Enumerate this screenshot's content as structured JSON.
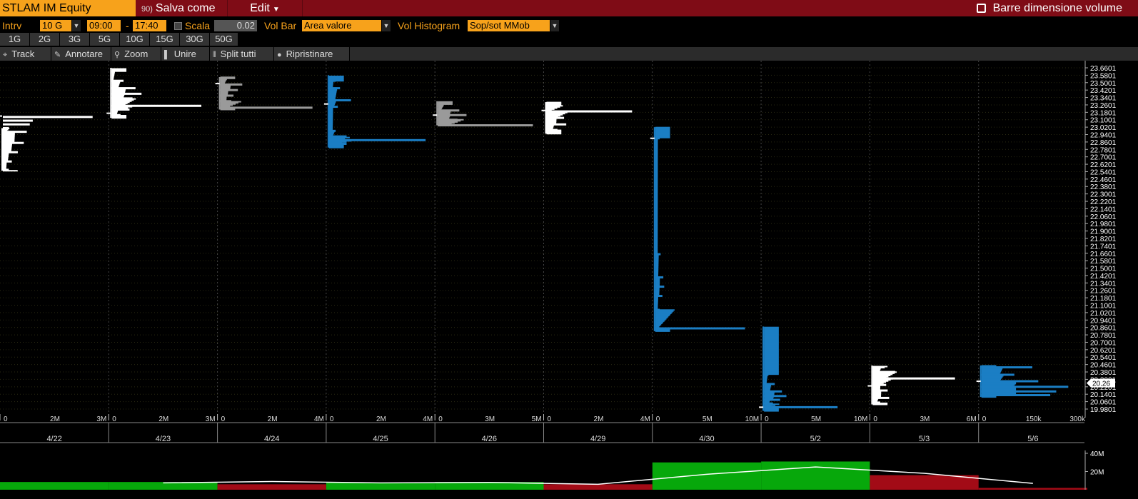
{
  "header": {
    "ticker": "STLAM IM Equity",
    "save_as": "Salva come",
    "save_icon_glyph": "90)",
    "edit": "Edit",
    "barre": "Barre dimensione volume"
  },
  "controls": {
    "intrv_label": "Intrv",
    "intrv_value": "10 G",
    "start_time": "09:00",
    "dash": "-",
    "end_time": "17:40",
    "scala_label": "Scala",
    "scala_value": "0.02",
    "volbar_label": "Vol Bar",
    "volbar_value": "Area valore",
    "volhist_label": "Vol Histogram",
    "volhist_value": "Sop/sot MMob"
  },
  "periods": [
    "1G",
    "2G",
    "3G",
    "5G",
    "10G",
    "15G",
    "30G",
    "50G"
  ],
  "toolbar": [
    {
      "label": "Track",
      "icon": "crosshair-icon",
      "glyph": "⌖"
    },
    {
      "label": "Annotare",
      "icon": "pencil-icon",
      "glyph": "✎"
    },
    {
      "label": "Zoom",
      "icon": "magnifier-icon",
      "glyph": "⚲"
    },
    {
      "label": "Unire",
      "icon": "merge-icon",
      "glyph": "▌"
    },
    {
      "label": "Split tutti",
      "icon": "split-icon",
      "glyph": "⫴"
    },
    {
      "label": "Ripristinare",
      "icon": "reset-icon",
      "glyph": "●"
    }
  ],
  "colors": {
    "title_bar": "#7f0c16",
    "accent": "#f7a21b",
    "up": "#07a80b",
    "down": "#a20b16",
    "profile_blue": "#1b7ec4",
    "profile_white": "#ffffff",
    "profile_gray": "#9a9a9a"
  },
  "chart_data": {
    "type": "bar",
    "title": "",
    "price_axis": {
      "ticks": [
        "23.6601",
        "23.5801",
        "23.5001",
        "23.4201",
        "23.3401",
        "23.2601",
        "23.1801",
        "23.1001",
        "23.0201",
        "22.9401",
        "22.8601",
        "22.7801",
        "22.7001",
        "22.6201",
        "22.5401",
        "22.4601",
        "22.3801",
        "22.3001",
        "22.2201",
        "22.1401",
        "22.0601",
        "21.9801",
        "21.9001",
        "21.8201",
        "21.7401",
        "21.6601",
        "21.5801",
        "21.5001",
        "21.4201",
        "21.3401",
        "21.2601",
        "21.1801",
        "21.1001",
        "21.0201",
        "20.9401",
        "20.8601",
        "20.7801",
        "20.7001",
        "20.6201",
        "20.5401",
        "20.4601",
        "20.3801",
        "20.3001",
        "20.2201",
        "20.1401",
        "20.0601",
        "19.9801"
      ],
      "last_price": "20.26",
      "range": [
        19.95,
        23.7
      ]
    },
    "sessions": [
      {
        "date": "4/22",
        "color": "white",
        "high": 23.01,
        "low": 22.55,
        "close": 23.14,
        "poc": 23.13,
        "axis_labels": [
          "0",
          "2M",
          "3M"
        ],
        "axis_max": 3.3,
        "poc_volume": 3.0,
        "profile": [
          [
            23.01,
            0.2
          ],
          [
            23.13,
            3.0
          ],
          [
            23.09,
            1.0
          ],
          [
            23.05,
            0.9
          ],
          [
            22.97,
            0.8
          ],
          [
            22.85,
            0.7
          ],
          [
            22.75,
            0.5
          ],
          [
            22.65,
            0.3
          ],
          [
            22.56,
            0.2
          ]
        ]
      },
      {
        "date": "4/23",
        "color": "white",
        "high": 23.66,
        "low": 23.12,
        "close": 23.17,
        "poc": 23.25,
        "axis_labels": [
          "0",
          "2M",
          "3M"
        ],
        "axis_max": 3.3,
        "poc_volume": 3.0,
        "profile": [
          [
            23.62,
            0.1
          ],
          [
            23.52,
            0.4
          ],
          [
            23.44,
            0.8
          ],
          [
            23.38,
            1.0
          ],
          [
            23.33,
            0.7
          ],
          [
            23.25,
            3.0
          ],
          [
            23.21,
            0.6
          ],
          [
            23.15,
            0.3
          ]
        ]
      },
      {
        "date": "4/24",
        "color": "gray",
        "high": 23.56,
        "low": 23.21,
        "close": 23.49,
        "poc": 23.23,
        "axis_labels": [
          "0",
          "2M",
          "4M"
        ],
        "axis_max": 4.5,
        "poc_volume": 4.2,
        "profile": [
          [
            23.54,
            0.3
          ],
          [
            23.48,
            1.0
          ],
          [
            23.42,
            0.8
          ],
          [
            23.36,
            0.6
          ],
          [
            23.3,
            0.5
          ],
          [
            23.23,
            4.2
          ]
        ]
      },
      {
        "date": "4/25",
        "color": "blue",
        "high": 23.58,
        "low": 22.8,
        "close": 23.27,
        "poc": 22.88,
        "axis_labels": [
          "0",
          "2M",
          "4M"
        ],
        "axis_max": 4.5,
        "poc_volume": 4.4,
        "profile": [
          [
            23.52,
            0.3
          ],
          [
            23.44,
            0.5
          ],
          [
            23.31,
            1.0
          ],
          [
            23.24,
            0.4
          ],
          [
            22.98,
            0.3
          ],
          [
            22.92,
            0.8
          ],
          [
            22.88,
            4.4
          ],
          [
            22.84,
            0.8
          ]
        ]
      },
      {
        "date": "4/26",
        "color": "gray",
        "high": 23.3,
        "low": 23.04,
        "close": 23.15,
        "poc": 23.04,
        "axis_labels": [
          "0",
          "3M",
          "5M"
        ],
        "axis_max": 5.5,
        "poc_volume": 5.3,
        "profile": [
          [
            23.26,
            0.3
          ],
          [
            23.2,
            1.2
          ],
          [
            23.15,
            1.6
          ],
          [
            23.1,
            1.1
          ],
          [
            23.04,
            5.3
          ]
        ]
      },
      {
        "date": "4/29",
        "color": "white",
        "high": 23.29,
        "low": 22.95,
        "close": 23.2,
        "poc": 23.19,
        "axis_labels": [
          "0",
          "2M",
          "4M"
        ],
        "axis_max": 4.5,
        "poc_volume": 3.9,
        "profile": [
          [
            23.26,
            0.2
          ],
          [
            23.19,
            3.9
          ],
          [
            23.12,
            0.8
          ],
          [
            23.05,
            0.9
          ],
          [
            22.99,
            0.5
          ]
        ]
      },
      {
        "date": "4/30",
        "color": "blue",
        "high": 23.02,
        "low": 20.82,
        "close": 22.9,
        "poc": 20.85,
        "axis_labels": [
          "0",
          "5M",
          "10M"
        ],
        "axis_max": 11.0,
        "poc_volume": 10.0,
        "profile": [
          [
            22.9,
            0.5
          ],
          [
            21.65,
            0.6
          ],
          [
            21.4,
            0.9
          ],
          [
            21.3,
            1.0
          ],
          [
            21.2,
            0.8
          ],
          [
            21.05,
            0.5
          ],
          [
            20.85,
            10.0
          ]
        ]
      },
      {
        "date": "5/2",
        "color": "blue",
        "high": 20.87,
        "low": 19.96,
        "close": 20.0,
        "poc": 20.0,
        "axis_labels": [
          "0",
          "5M",
          "10M"
        ],
        "axis_max": 11.0,
        "poc_volume": 8.2,
        "profile": [
          [
            20.35,
            0.5
          ],
          [
            20.25,
            1.2
          ],
          [
            20.17,
            2.0
          ],
          [
            20.12,
            2.5
          ],
          [
            20.08,
            1.8
          ],
          [
            20.04,
            1.0
          ],
          [
            20.0,
            8.2
          ]
        ]
      },
      {
        "date": "5/3",
        "color": "white",
        "high": 20.45,
        "low": 20.03,
        "close": 20.23,
        "poc": 20.31,
        "axis_labels": [
          "0",
          "3M",
          "6M"
        ],
        "axis_max": 6.6,
        "poc_volume": 5.5,
        "profile": [
          [
            20.43,
            0.8
          ],
          [
            20.38,
            1.5
          ],
          [
            20.31,
            5.5
          ],
          [
            20.24,
            0.9
          ],
          [
            20.18,
            1.0
          ],
          [
            20.1,
            1.1
          ],
          [
            20.05,
            0.5
          ]
        ]
      },
      {
        "date": "5/6",
        "color": "blue",
        "high": 20.45,
        "low": 20.11,
        "close": 20.28,
        "poc": 20.22,
        "axis_labels": [
          "0",
          "150k",
          "300k"
        ],
        "axis_max": 330,
        "poc_volume": 290,
        "profile": [
          [
            20.43,
            170
          ],
          [
            20.35,
            110
          ],
          [
            20.28,
            190
          ],
          [
            20.22,
            290
          ],
          [
            20.17,
            250
          ],
          [
            20.13,
            230
          ]
        ]
      }
    ],
    "volume_pane": {
      "ticks": [
        "40M",
        "20M"
      ],
      "range": [
        0,
        40
      ],
      "bars": [
        {
          "date": "4/22",
          "volume": 8.5,
          "direction": "up"
        },
        {
          "date": "4/23",
          "volume": 8.5,
          "direction": "up"
        },
        {
          "date": "4/24",
          "volume": 6.0,
          "direction": "down"
        },
        {
          "date": "4/25",
          "volume": 8.0,
          "direction": "up"
        },
        {
          "date": "4/26",
          "volume": 8.5,
          "direction": "up"
        },
        {
          "date": "4/29",
          "volume": 6.0,
          "direction": "down"
        },
        {
          "date": "4/30",
          "volume": 30.0,
          "direction": "up"
        },
        {
          "date": "5/2",
          "volume": 31.0,
          "direction": "up"
        },
        {
          "date": "5/3",
          "volume": 16.0,
          "direction": "down"
        },
        {
          "date": "5/6",
          "volume": 2.0,
          "direction": "down"
        }
      ],
      "moving_average": [
        null,
        7.5,
        9.0,
        7.5,
        8.0,
        6.0,
        17.0,
        25.0,
        18.0,
        7.0
      ]
    }
  }
}
